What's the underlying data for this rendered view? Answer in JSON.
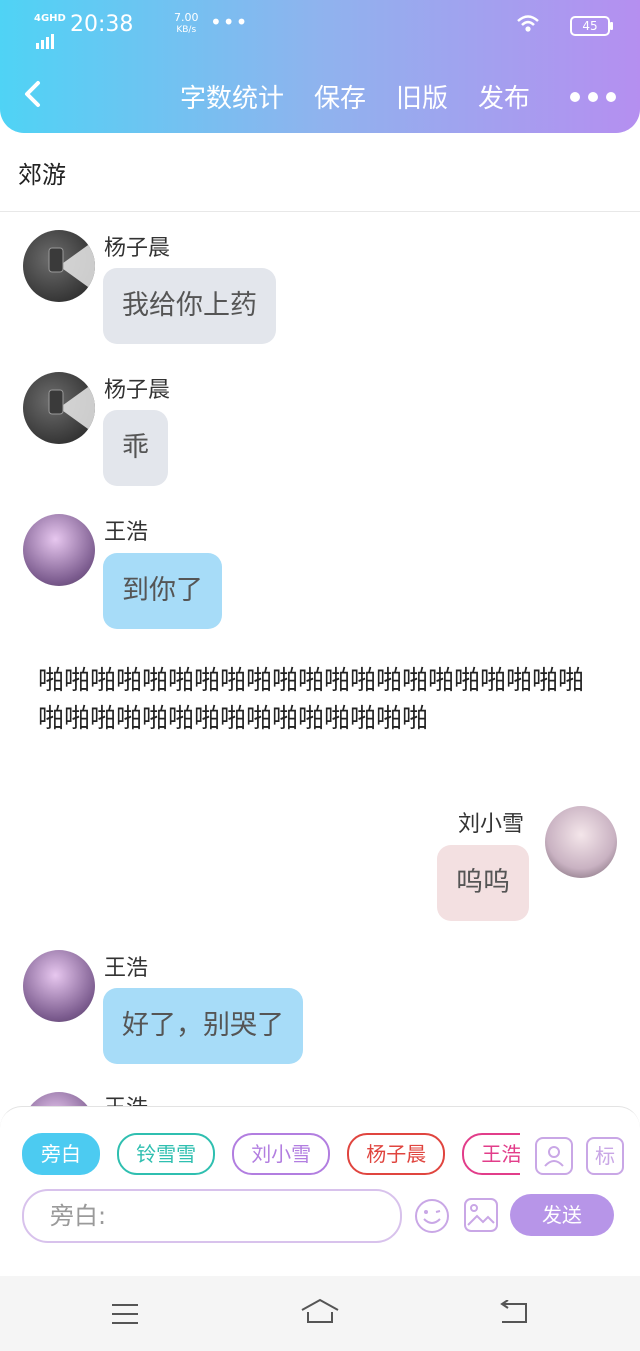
{
  "status_bar": {
    "network": "4GHD",
    "time": "20:38",
    "speed_value": "7.00",
    "speed_unit": "KB/s",
    "more": "•••",
    "battery": "45"
  },
  "header": {
    "actions": [
      "字数统计",
      "保存",
      "旧版",
      "发布"
    ]
  },
  "page": {
    "title": "郊游"
  },
  "messages": [
    {
      "speaker": "杨子晨",
      "text": "我给你上药"
    },
    {
      "speaker": "杨子晨",
      "text": "乖"
    },
    {
      "speaker": "王浩",
      "text": "到你了"
    },
    {
      "narration": "啪啪啪啪啪啪啪啪啪啪啪啪啪啪啪啪啪啪啪啪啪啪啪啪啪啪啪啪啪啪啪啪啪啪啪啪"
    },
    {
      "speaker": "刘小雪",
      "text": "呜呜"
    },
    {
      "speaker": "王浩",
      "text": "好了，别哭了"
    },
    {
      "speaker": "王浩"
    }
  ],
  "composer": {
    "roles": [
      "旁白",
      "铃雪雪",
      "刘小雪",
      "杨子晨",
      "王浩"
    ],
    "tag_label": "标",
    "placeholder": "旁白:",
    "send_label": "发送"
  },
  "colors": {
    "accent_cyan": "#4ccbf1",
    "accent_purple": "#b795e8",
    "chip_teal": "#2fbfb0",
    "chip_purple": "#b27ee0",
    "chip_red": "#e0453f",
    "chip_pink": "#e23d8a"
  }
}
